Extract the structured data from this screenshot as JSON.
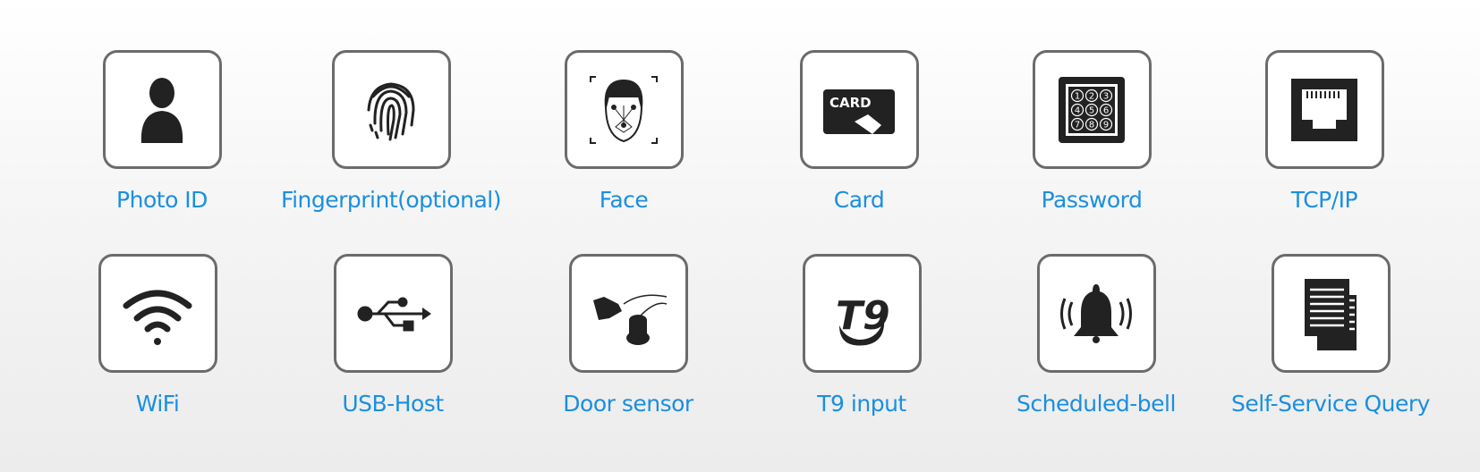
{
  "accent_color": "#1a8fe0",
  "features": [
    {
      "label": "Photo ID",
      "icon": "person-icon"
    },
    {
      "label": "Fingerprint(optional)",
      "icon": "fingerprint-icon"
    },
    {
      "label": "Face",
      "icon": "face-icon"
    },
    {
      "label": "Card",
      "icon": "card-icon",
      "icon_text": "CARD"
    },
    {
      "label": "Password",
      "icon": "keypad-icon",
      "icon_text": "123456789"
    },
    {
      "label": "TCP/IP",
      "icon": "ethernet-port-icon"
    },
    {
      "label": "WiFi",
      "icon": "wifi-icon"
    },
    {
      "label": "USB-Host",
      "icon": "usb-icon"
    },
    {
      "label": "Door sensor",
      "icon": "door-sensor-icon"
    },
    {
      "label": "T9 input",
      "icon": "t9-icon",
      "icon_text": "T9"
    },
    {
      "label": "Scheduled-bell",
      "icon": "bell-icon"
    },
    {
      "label": "Self-Service Query",
      "icon": "document-icon"
    }
  ]
}
